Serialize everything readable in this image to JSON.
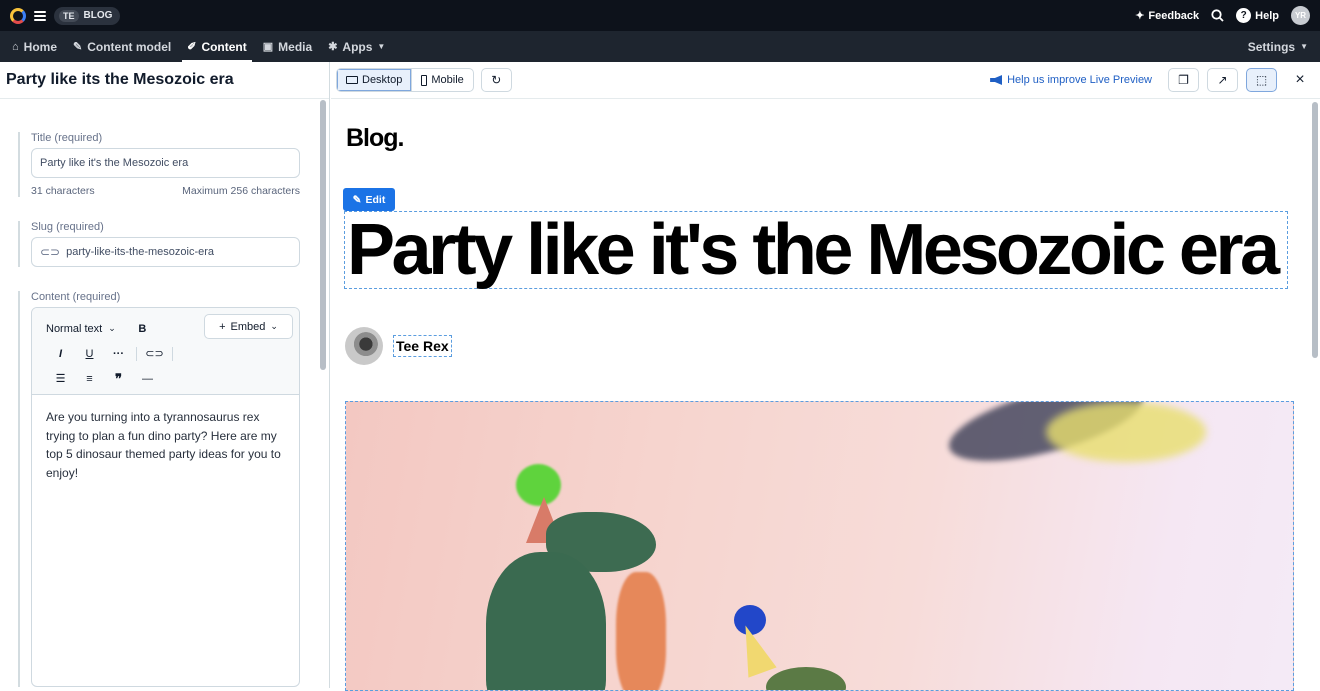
{
  "topbar": {
    "space_code": "TE",
    "space_name": "BLOG",
    "feedback": "Feedback",
    "help": "Help",
    "avatar_initials": "YR"
  },
  "nav": {
    "home": "Home",
    "content_model": "Content model",
    "content": "Content",
    "media": "Media",
    "apps": "Apps",
    "settings": "Settings"
  },
  "editor": {
    "entry_title": "Party like its the Mesozoic era",
    "title_field": {
      "label": "Title (required)",
      "value": "Party like it's the Mesozoic era",
      "char_count": "31 characters",
      "max": "Maximum 256 characters"
    },
    "slug_field": {
      "label": "Slug (required)",
      "value": "party-like-its-the-mesozoic-era"
    },
    "content_field": {
      "label": "Content (required)",
      "format_select": "Normal text",
      "embed_label": "Embed",
      "body": "Are you turning into a tyrannosaurus rex trying to plan a fun dino party? Here are my top 5 dinosaur themed party ideas for you to enjoy!"
    }
  },
  "preview": {
    "desktop": "Desktop",
    "mobile": "Mobile",
    "feedback_link": "Help us improve Live Preview",
    "blog_brand": "Blog.",
    "edit_label": "Edit",
    "post_title": "Party like it's the Mesozoic era",
    "author": "Tee Rex"
  },
  "colors": {
    "accent": "#1b73e6",
    "topbar": "#0d121b",
    "navbar": "#1e252f"
  }
}
